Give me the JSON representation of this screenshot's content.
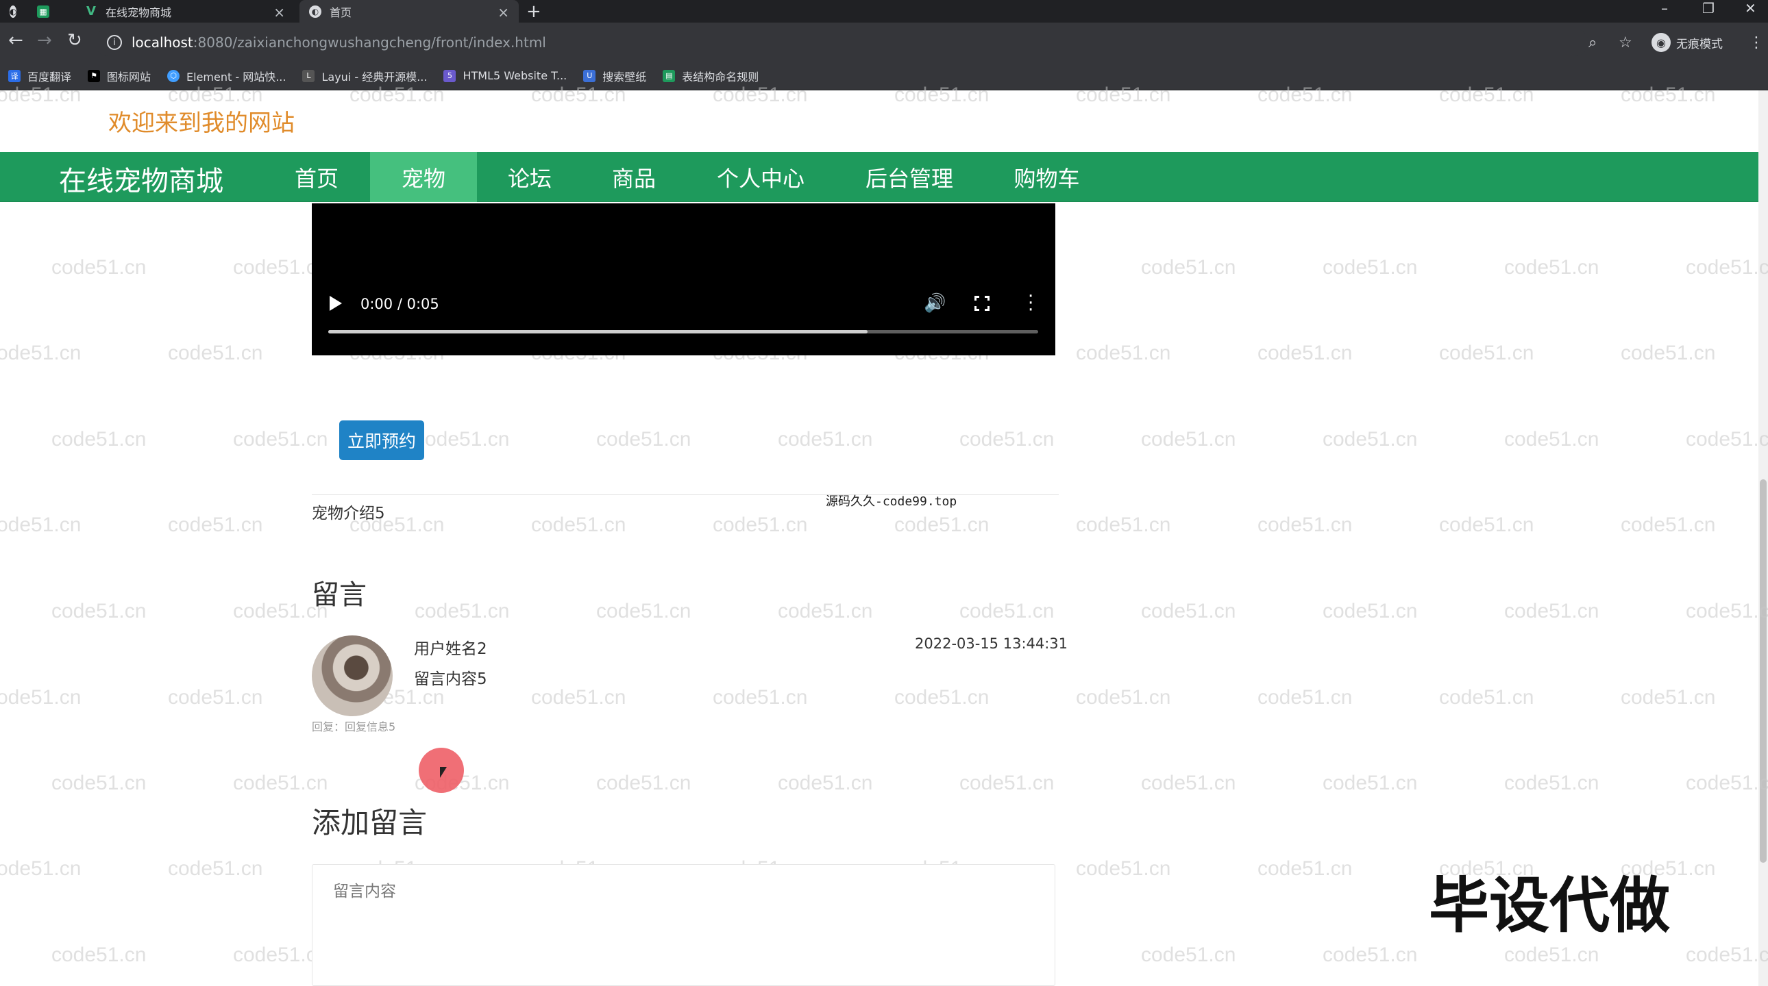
{
  "browser": {
    "tabs": [
      {
        "title": ""
      },
      {
        "title": ""
      },
      {
        "title": "在线宠物商城"
      },
      {
        "title": "首页"
      }
    ],
    "url_host": "localhost",
    "url_path": ":8080/zaixianchongwushangcheng/front/index.html",
    "profile_label": "无痕模式",
    "bookmarks": [
      {
        "label": "百度翻译",
        "color": "#2b6de8"
      },
      {
        "label": "图标网站",
        "color": "#333333"
      },
      {
        "label": "Element - 网站快...",
        "color": "#409eff"
      },
      {
        "label": "Layui - 经典开源模...",
        "color": "#555555"
      },
      {
        "label": "HTML5 Website T...",
        "color": "#6a5acd"
      },
      {
        "label": "搜索壁纸",
        "color": "#3b6fd6"
      },
      {
        "label": "表结构命名规则",
        "color": "#1e9a5c"
      }
    ]
  },
  "site": {
    "welcome": "欢迎来到我的网站",
    "name": "在线宠物商城",
    "nav": [
      {
        "label": "首页"
      },
      {
        "label": "宠物"
      },
      {
        "label": "论坛"
      },
      {
        "label": "商品"
      },
      {
        "label": "个人中心"
      },
      {
        "label": "后台管理"
      },
      {
        "label": "购物车"
      }
    ],
    "active_nav": "宠物",
    "accent_color": "#1e9a5c"
  },
  "video": {
    "time": "0:00 / 0:05",
    "buffered_fraction": 0.76
  },
  "detail": {
    "reserve_label": "立即预约",
    "intro": "宠物介绍5",
    "note": "源码久久-code99.top"
  },
  "comments": {
    "title": "留言",
    "items": [
      {
        "user": "用户姓名2",
        "content": "留言内容5",
        "time": "2022-03-15 13:44:31",
        "reply": "回复：回复信息5"
      }
    ]
  },
  "add_comment": {
    "title": "添加留言",
    "placeholder": "留言内容"
  },
  "overlay": {
    "brand": "毕设代做",
    "watermark": "code51.cn"
  }
}
